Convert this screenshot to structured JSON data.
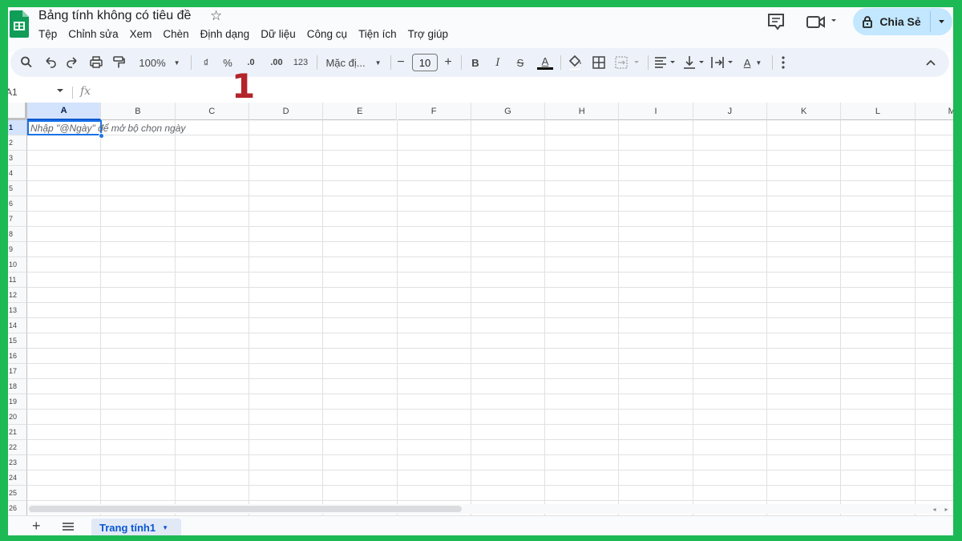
{
  "app": {
    "title": "Bảng tính không có tiêu đề"
  },
  "menu": [
    "Tệp",
    "Chỉnh sửa",
    "Xem",
    "Chèn",
    "Định dạng",
    "Dữ liệu",
    "Công cụ",
    "Tiện ích",
    "Trợ giúp"
  ],
  "share": {
    "label": "Chia Sẻ"
  },
  "toolbar": {
    "zoom": "100%",
    "currency": "₫",
    "percent": "%",
    "decrease_decimals": ".0",
    "increase_decimals": ".00",
    "number_format": "123",
    "font": "Mặc đị...",
    "font_size": "10",
    "minus": "−",
    "plus": "+",
    "bold": "B",
    "italic": "I",
    "strike": "S",
    "text_color": "A",
    "text_rotation": "A"
  },
  "formula_bar": {
    "cell_ref": "A1",
    "fx": "fx",
    "value": ""
  },
  "annotation_marker": "1",
  "grid": {
    "columns": [
      "A",
      "B",
      "C",
      "D",
      "E",
      "F",
      "G",
      "H",
      "I",
      "J",
      "K",
      "L",
      "M"
    ],
    "rows": [
      "1",
      "2",
      "3",
      "4",
      "5",
      "6",
      "7",
      "8",
      "9",
      "10",
      "11",
      "12",
      "13",
      "14",
      "15",
      "16",
      "17",
      "18",
      "19",
      "20",
      "21",
      "22",
      "23",
      "24",
      "25",
      "26"
    ],
    "selected_cell": "A1",
    "cell_hint": "Nhập \"@Ngày\" để mở bộ chọn ngày"
  },
  "sheets": {
    "tabs": [
      {
        "label": "Trang tính1"
      }
    ]
  },
  "colors": {
    "frame": "#1db954",
    "accent": "#1a73e8",
    "share_bg": "#c2e7ff",
    "toolbar_bg": "#edf2fa",
    "marker": "#b3242b"
  }
}
